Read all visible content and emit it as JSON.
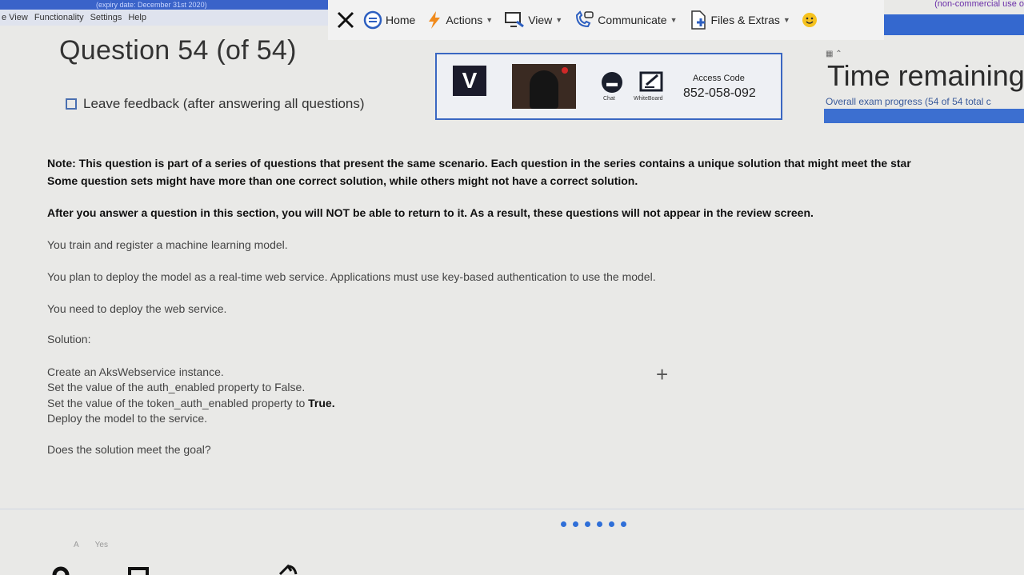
{
  "titlebar": {
    "text": "(expiry date: December 31st 2020)"
  },
  "menubar": {
    "items": [
      "e View",
      "Functionality",
      "Settings",
      "Help"
    ]
  },
  "toolbar": {
    "home": "Home",
    "actions": "Actions",
    "view": "View",
    "communicate": "Communicate",
    "files_extras": "Files & Extras"
  },
  "license_text": "(non-commercial use o",
  "question": {
    "title": "Question 54 (of 54)",
    "feedback_label": "Leave feedback (after answering all questions)"
  },
  "proctor": {
    "chat_label": "Chat",
    "whiteboard_label": "WhiteBoard",
    "access_code_label": "Access Code",
    "access_code": "852-058-092"
  },
  "timer": {
    "title": "Time remaining",
    "progress_text": "Overall exam progress (54 of 54 total c",
    "progress": 1.0
  },
  "body": {
    "note_1": "Note: This question is part of a series of questions that present the same scenario. Each question in the series contains a unique solution that might meet the star",
    "note_2": "Some question sets might have more than one correct solution, while others might not have a correct solution.",
    "note_3": "After you answer a question in this section, you will NOT be able to return to it. As a result, these questions will not appear in the review screen.",
    "line_1": "You train and register a machine learning model.",
    "line_2": "You plan to deploy the model as a real-time web service. Applications must use key-based authentication to use the model.",
    "line_3": "You need to deploy the web service.",
    "solution_label": "Solution:",
    "step_1": "Create an AksWebservice instance.",
    "step_2": "Set the value of the auth_enabled property to False.",
    "step_3a": "Set the value of the token_auth_enabled property to",
    "step_3b": "True.",
    "step_4": "Deploy the model to the service.",
    "question": "Does the solution meet the goal?"
  },
  "answer": {
    "option_a_prefix": "A",
    "option_a": "Yes"
  },
  "colors": {
    "accent": "#3468cf",
    "link": "#2f6fd8"
  }
}
